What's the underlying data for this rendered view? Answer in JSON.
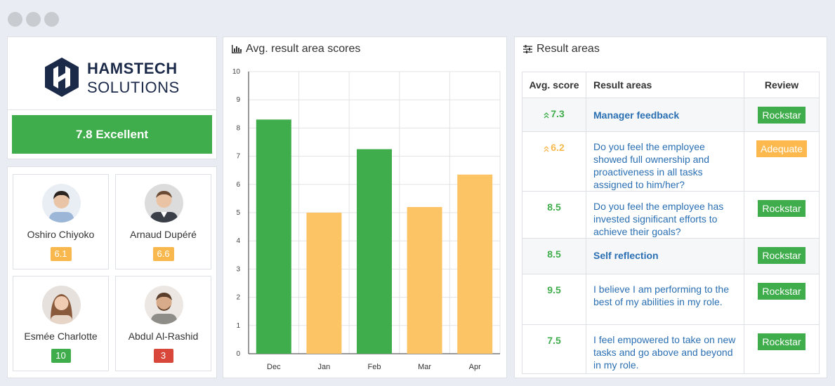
{
  "window": {
    "controls": [
      "close",
      "minimize",
      "maximize"
    ]
  },
  "brand": {
    "line1": "HAMSTECH",
    "line2": "SOLUTIONS"
  },
  "overall": {
    "label": "7.8 Excellent",
    "color": "#3fad4b"
  },
  "people": [
    {
      "name": "Oshiro Chiyoko",
      "score": "6.1",
      "badge_color": "#f9b84d"
    },
    {
      "name": "Arnaud Dupéré",
      "score": "6.6",
      "badge_color": "#f9b84d"
    },
    {
      "name": "Esmée Charlotte",
      "score": "10",
      "badge_color": "#3fad4b"
    },
    {
      "name": "Abdul Al-Rashid",
      "score": "3",
      "badge_color": "#d9473a"
    }
  ],
  "chart_panel": {
    "title": "Avg. result area scores",
    "icon": "bar-chart-icon"
  },
  "chart_data": {
    "type": "bar",
    "categories": [
      "Dec",
      "Jan",
      "Feb",
      "Mar",
      "Apr"
    ],
    "values": [
      8.3,
      5.0,
      7.25,
      5.2,
      6.35
    ],
    "colors": [
      "#3fad4b",
      "#fdc466",
      "#3fad4b",
      "#fdc466",
      "#fdc466"
    ],
    "ylim": [
      0,
      10
    ],
    "yticks": [
      "0",
      "1",
      "2",
      "3",
      "4",
      "5",
      "6",
      "7",
      "8",
      "9",
      "10"
    ],
    "grid": true,
    "title": "",
    "xlabel": "",
    "ylabel": ""
  },
  "table_panel": {
    "title": "Result areas",
    "icon": "sliders-icon",
    "headers": {
      "score": "Avg. score",
      "areas": "Result areas",
      "review": "Review"
    },
    "rows": [
      {
        "score": "7.3",
        "trend": "up",
        "score_color": "#3fad4b",
        "area": "Manager feedback",
        "bold": true,
        "review": "Rockstar",
        "review_color": "#3fad4b"
      },
      {
        "score": "6.2",
        "trend": "up",
        "score_color": "#f9b84d",
        "area": "Do you feel the employee showed full ownership and proactiveness in all tasks assigned to him/her?",
        "bold": false,
        "review": "Adequate",
        "review_color": "#fdb94d"
      },
      {
        "score": "8.5",
        "trend": "",
        "score_color": "#3fad4b",
        "area": "Do you feel the employee has invested significant efforts to achieve their goals?",
        "bold": false,
        "review": "Rockstar",
        "review_color": "#3fad4b"
      },
      {
        "score": "8.5",
        "trend": "",
        "score_color": "#3fad4b",
        "area": "Self reflection",
        "bold": true,
        "review": "Rockstar",
        "review_color": "#3fad4b"
      },
      {
        "score": "9.5",
        "trend": "",
        "score_color": "#3fad4b",
        "area": "I believe I am performing to the best of my abilities in my role.",
        "bold": false,
        "review": "Rockstar",
        "review_color": "#3fad4b"
      },
      {
        "score": "7.5",
        "trend": "",
        "score_color": "#3fad4b",
        "area": "I feel empowered to take on new tasks and go above and beyond in my role.",
        "bold": false,
        "review": "Rockstar",
        "review_color": "#3fad4b"
      }
    ]
  }
}
